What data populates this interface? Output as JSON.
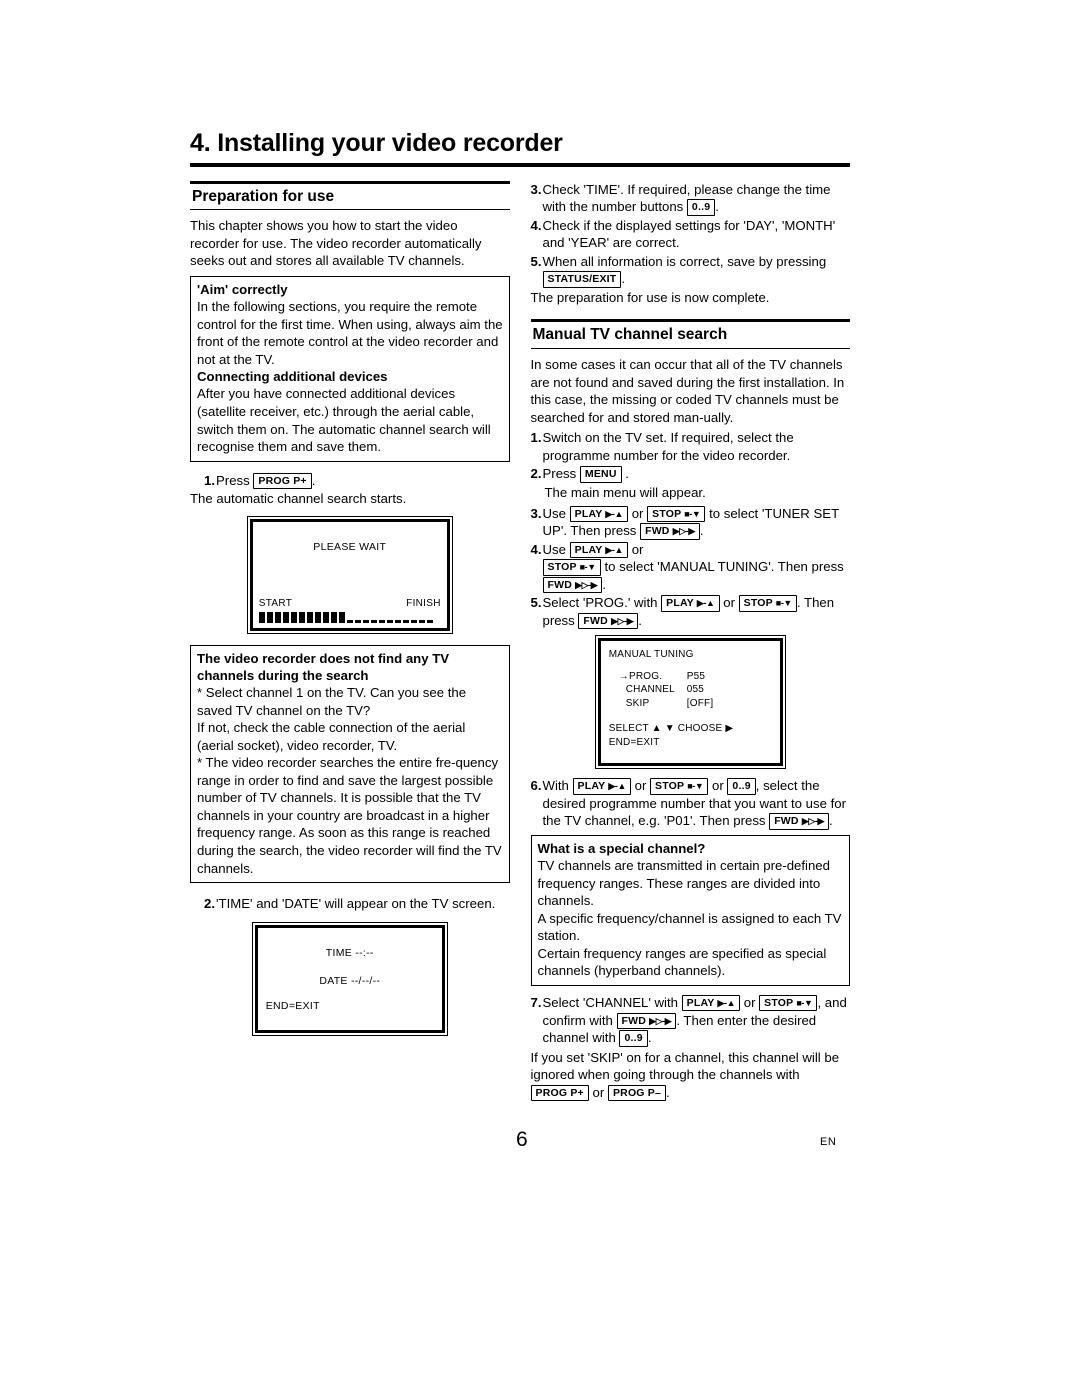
{
  "document": {
    "chapter_title": "4. Installing your video recorder",
    "page_number": "6",
    "language_code": "EN"
  },
  "keys": {
    "prog_p_plus": "PROG P+",
    "prog_p_minus": "PROG P–",
    "menu": "MENU",
    "status_exit": "STATUS/EXIT",
    "numbers": "0..9",
    "play": "PLAY",
    "play_glyph": "▶-▲",
    "stop": "STOP",
    "stop_glyph": "■-▼",
    "fwd": "FWD",
    "fwd_glyph": "▶▷-▶"
  },
  "left_column": {
    "section": {
      "heading": "Preparation for use",
      "intro": "This chapter shows you how to start the video recorder for use. The video recorder automatically seeks out and stores all available TV channels."
    },
    "aim_box": {
      "title": "'Aim' correctly",
      "body": "In the following sections, you require the remote control for the first time. When using, always aim the front of the remote control at the video recorder and not at the TV.",
      "subtitle": "Connecting additional devices",
      "subbody": "After you have connected additional devices (satellite receiver, etc.) through the aerial cable, switch them on. The automatic channel search will recognise them and save them."
    },
    "step1": {
      "num": "1.",
      "text_before": "Press",
      "text_after": ".",
      "follow": "The automatic channel search starts."
    },
    "please_wait_screen": {
      "title": "PLEASE WAIT",
      "start_label": "START",
      "finish_label": "FINISH",
      "bars_filled": 11,
      "bars_empty": 11
    },
    "nofind_box": {
      "title_line1": "The video recorder does not find any TV",
      "title_line2": "channels during the search",
      "p1": "* Select channel 1 on the TV. Can you see the saved TV channel on the TV?",
      "p2": "If not, check the cable connection of the aerial (aerial socket), video recorder, TV.",
      "p3": "* The video recorder searches the entire fre-quency range in order to find and save the largest possible number of TV channels. It is possible that the TV channels in your country are broadcast in a higher frequency range. As soon as this range is reached during the search, the video recorder will find the TV channels."
    },
    "step2": {
      "num": "2.",
      "text": "'TIME' and 'DATE' will appear on the TV screen."
    },
    "time_screen": {
      "time_label": "TIME",
      "time_value": "--:--",
      "date_label": "DATE",
      "date_value": "--/--/--",
      "end_label": "END=EXIT"
    }
  },
  "right_column": {
    "prep_steps": [
      {
        "num": "3.",
        "before": "Check 'TIME'. If required, please change the time with the number buttons",
        "key": "0..9",
        "after": "."
      },
      {
        "num": "4.",
        "before": "Check if the displayed settings for 'DAY', 'MONTH' and 'YEAR' are correct.",
        "key": "",
        "after": ""
      },
      {
        "num": "5.",
        "before": "When all information is correct, save by pressing",
        "key": "STATUS/EXIT",
        "after": "."
      }
    ],
    "prep_closing": "The preparation for use is now complete.",
    "section": {
      "heading": "Manual TV channel search",
      "intro": "In some cases it can occur that all of the TV channels are not found and saved during the first installation. In this case, the missing or coded TV channels must be searched for and stored man-ually."
    },
    "step1": {
      "num": "1.",
      "text": "Switch on the TV set. If required, select the programme number for the video recorder."
    },
    "step2": {
      "num": "2.",
      "before": "Press",
      "after": ".",
      "follow": "The main menu will appear."
    },
    "step3": {
      "num": "3.",
      "t1": "Use",
      "t2": "or",
      "t3": "to select 'TUNER SET UP'. Then press",
      "t4": "."
    },
    "step4": {
      "num": "4.",
      "t1": "Use",
      "t2": "or",
      "t3": "to select 'MANUAL TUNING'. Then press",
      "t4": "."
    },
    "step5": {
      "num": "5.",
      "t1": "Select 'PROG.' with",
      "t2": "or",
      "t3": ". Then press",
      "t4": "."
    },
    "manual_tuning_screen": {
      "title": "MANUAL TUNING",
      "rows": [
        {
          "arrow": "→",
          "label": "PROG.",
          "value": "P55"
        },
        {
          "arrow": "",
          "label": "CHANNEL",
          "value": "055"
        },
        {
          "arrow": "",
          "label": "SKIP",
          "value": "[OFF]"
        }
      ],
      "footer_line1": "SELECT ▲ ▼  CHOOSE ▶",
      "footer_line2": "END=EXIT"
    },
    "step6": {
      "num": "6.",
      "t1": "With",
      "t2": "or",
      "t3": "or",
      "t4": ", select the desired programme number that you want to use for the TV channel, e.g. 'P01'. Then press",
      "t5": "."
    },
    "special_box": {
      "title": "What is a special channel?",
      "p1": "TV channels are transmitted in certain pre-defined frequency ranges. These ranges are divided into channels.",
      "p2": "A specific frequency/channel is assigned to each TV station.",
      "p3": "Certain frequency ranges are specified as special channels (hyperband channels)."
    },
    "step7": {
      "num": "7.",
      "t1": "Select 'CHANNEL' with",
      "t2": "or",
      "t3": ", and confirm with",
      "t4": ". Then enter the desired channel with",
      "t5": "."
    },
    "closing": {
      "t1": "If you set 'SKIP' on for a channel, this channel will be ignored when going through the channels with",
      "t2": "or",
      "t3": "."
    }
  }
}
